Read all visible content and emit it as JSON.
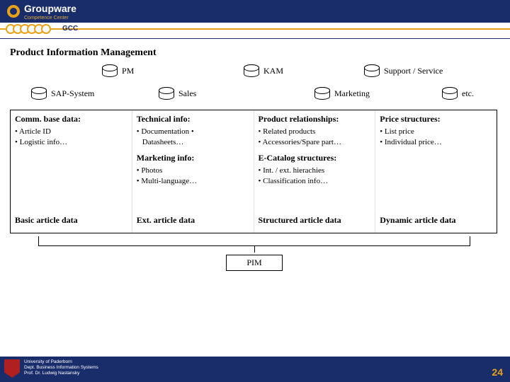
{
  "header": {
    "brand": "Groupware",
    "sub1": "Competence Center",
    "sub2": "GCC"
  },
  "title": "Product Information Management",
  "row1": [
    {
      "label": "PM"
    },
    {
      "label": "KAM"
    },
    {
      "label": "Support / Service"
    }
  ],
  "row2": [
    {
      "label": "SAP-System"
    },
    {
      "label": "Sales"
    },
    {
      "label": "Marketing"
    },
    {
      "label": "etc."
    }
  ],
  "columns": [
    {
      "heading": "Comm. base data:",
      "items": [
        "Article ID",
        "Logistic info…"
      ],
      "heading2": "",
      "items2": [],
      "footer": "Basic article data"
    },
    {
      "heading": "Technical info:",
      "items": [
        "Documentation •",
        "Datasheets…"
      ],
      "heading2": "Marketing info:",
      "items2": [
        "Photos",
        "Multi-language…"
      ],
      "footer": "Ext. article data"
    },
    {
      "heading": "Product relationships:",
      "items": [
        "Related products",
        "Accessories/Spare part…"
      ],
      "heading2": "E-Catalog structures:",
      "items2": [
        "Int. / ext. hierachies",
        "Classification info…"
      ],
      "footer": "Structured article data"
    },
    {
      "heading": "Price structures:",
      "items": [
        "List price",
        "Individual price…"
      ],
      "heading2": "",
      "items2": [],
      "footer": "Dynamic article data"
    }
  ],
  "pim": "PIM",
  "footer": {
    "l1": "University of Paderborn",
    "l2": "Dept. Business Information Systems",
    "l3": "Prof. Dr. Ludwig Nastansky",
    "page": "24"
  }
}
